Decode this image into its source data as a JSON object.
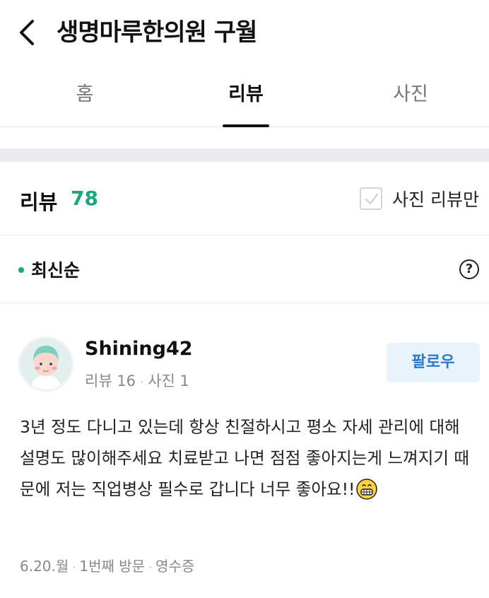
{
  "header": {
    "title": "생명마루한의원 구월",
    "back_icon": "chevron-left-icon"
  },
  "tabs": [
    {
      "label": "홈",
      "active": false
    },
    {
      "label": "리뷰",
      "active": true
    },
    {
      "label": "사진",
      "active": false
    }
  ],
  "review_header": {
    "title": "리뷰",
    "count": "78",
    "photo_only_label": "사진 리뷰만",
    "photo_only_checked": false
  },
  "sort": {
    "label": "최신순",
    "help_icon": "question-circle-icon"
  },
  "review": {
    "user_name": "Shining42",
    "review_count_label": "리뷰 16",
    "photo_count_label": "사진 1",
    "follow_label": "팔로우",
    "body": "3년 정도 다니고 있는데 항상 친절하시고 평소 자세 관리에 대해 설명도 많이해주세요 치료받고 나면 점점 좋아지는게 느껴지기 때문에 저는 직업병상 필수로 갑니다 너무 좋아요!!",
    "emoji": "grinning-face-emoji",
    "date": "6.20.월",
    "visit": "1번째 방문",
    "receipt": "영수증"
  },
  "colors": {
    "accent_green": "#1aa77a",
    "follow_blue": "#2b7ac9",
    "follow_bg": "#e9f3fb"
  }
}
